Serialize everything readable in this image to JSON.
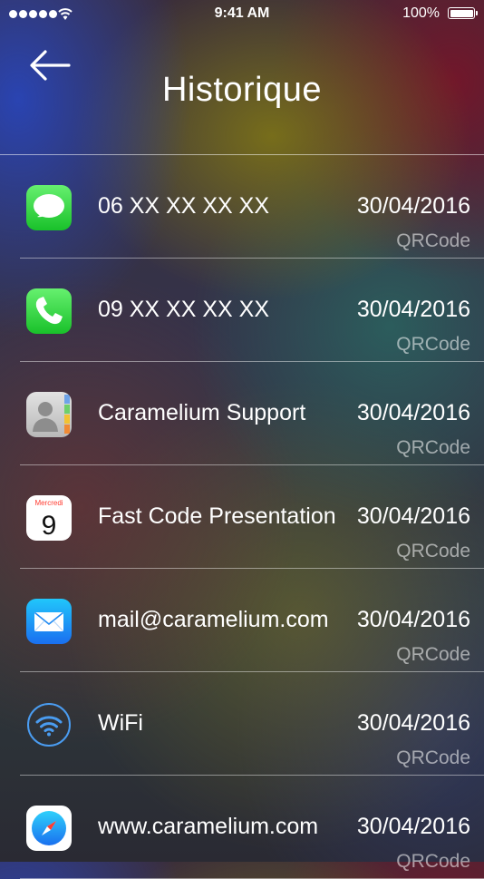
{
  "status_bar": {
    "time": "9:41 AM",
    "battery": "100%"
  },
  "header": {
    "title": "Historique"
  },
  "history": [
    {
      "icon": "messages-icon",
      "title": "06 XX XX XX XX",
      "date": "30/04/2016",
      "type": "QRCode"
    },
    {
      "icon": "phone-icon",
      "title": "09 XX XX XX XX",
      "date": "30/04/2016",
      "type": "QRCode"
    },
    {
      "icon": "contacts-icon",
      "title": "Caramelium Support",
      "date": "30/04/2016",
      "type": "QRCode"
    },
    {
      "icon": "calendar-icon",
      "title": "Fast Code Presentation",
      "date": "30/04/2016",
      "type": "QRCode",
      "calendar_day": "Mercredi",
      "calendar_date": "9"
    },
    {
      "icon": "mail-icon",
      "title": "mail@caramelium.com",
      "date": "30/04/2016",
      "type": "QRCode"
    },
    {
      "icon": "wifi-icon",
      "title": "WiFi",
      "date": "30/04/2016",
      "type": "QRCode"
    },
    {
      "icon": "safari-icon",
      "title": "www.caramelium.com",
      "date": "30/04/2016",
      "type": "QRCode"
    }
  ],
  "colors": {
    "messages": "#3fd352",
    "phone": "#3fd352",
    "mail": "#1c7cf0",
    "wifi": "#4a9cf0"
  }
}
